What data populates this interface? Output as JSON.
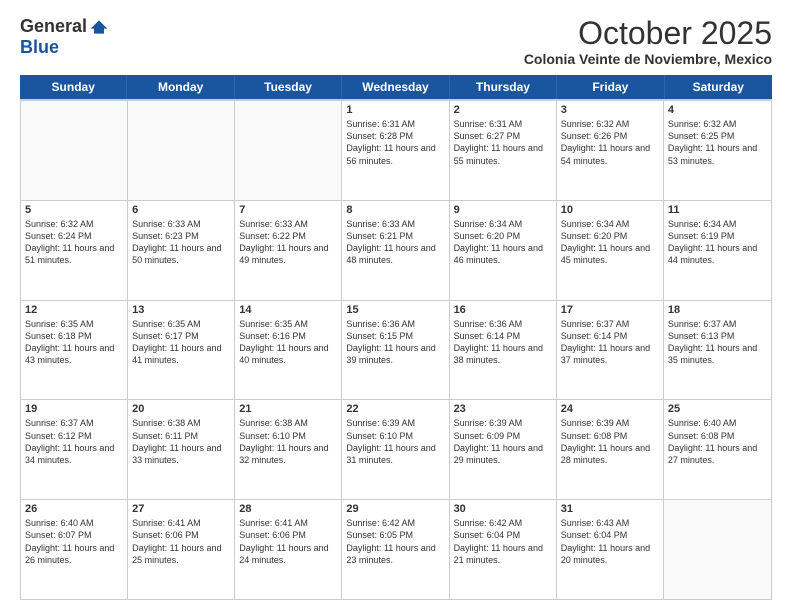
{
  "logo": {
    "general": "General",
    "blue": "Blue"
  },
  "header": {
    "month": "October 2025",
    "location": "Colonia Veinte de Noviembre, Mexico"
  },
  "weekdays": [
    "Sunday",
    "Monday",
    "Tuesday",
    "Wednesday",
    "Thursday",
    "Friday",
    "Saturday"
  ],
  "weeks": [
    [
      {
        "day": "",
        "info": ""
      },
      {
        "day": "",
        "info": ""
      },
      {
        "day": "",
        "info": ""
      },
      {
        "day": "1",
        "info": "Sunrise: 6:31 AM\nSunset: 6:28 PM\nDaylight: 11 hours and 56 minutes."
      },
      {
        "day": "2",
        "info": "Sunrise: 6:31 AM\nSunset: 6:27 PM\nDaylight: 11 hours and 55 minutes."
      },
      {
        "day": "3",
        "info": "Sunrise: 6:32 AM\nSunset: 6:26 PM\nDaylight: 11 hours and 54 minutes."
      },
      {
        "day": "4",
        "info": "Sunrise: 6:32 AM\nSunset: 6:25 PM\nDaylight: 11 hours and 53 minutes."
      }
    ],
    [
      {
        "day": "5",
        "info": "Sunrise: 6:32 AM\nSunset: 6:24 PM\nDaylight: 11 hours and 51 minutes."
      },
      {
        "day": "6",
        "info": "Sunrise: 6:33 AM\nSunset: 6:23 PM\nDaylight: 11 hours and 50 minutes."
      },
      {
        "day": "7",
        "info": "Sunrise: 6:33 AM\nSunset: 6:22 PM\nDaylight: 11 hours and 49 minutes."
      },
      {
        "day": "8",
        "info": "Sunrise: 6:33 AM\nSunset: 6:21 PM\nDaylight: 11 hours and 48 minutes."
      },
      {
        "day": "9",
        "info": "Sunrise: 6:34 AM\nSunset: 6:20 PM\nDaylight: 11 hours and 46 minutes."
      },
      {
        "day": "10",
        "info": "Sunrise: 6:34 AM\nSunset: 6:20 PM\nDaylight: 11 hours and 45 minutes."
      },
      {
        "day": "11",
        "info": "Sunrise: 6:34 AM\nSunset: 6:19 PM\nDaylight: 11 hours and 44 minutes."
      }
    ],
    [
      {
        "day": "12",
        "info": "Sunrise: 6:35 AM\nSunset: 6:18 PM\nDaylight: 11 hours and 43 minutes."
      },
      {
        "day": "13",
        "info": "Sunrise: 6:35 AM\nSunset: 6:17 PM\nDaylight: 11 hours and 41 minutes."
      },
      {
        "day": "14",
        "info": "Sunrise: 6:35 AM\nSunset: 6:16 PM\nDaylight: 11 hours and 40 minutes."
      },
      {
        "day": "15",
        "info": "Sunrise: 6:36 AM\nSunset: 6:15 PM\nDaylight: 11 hours and 39 minutes."
      },
      {
        "day": "16",
        "info": "Sunrise: 6:36 AM\nSunset: 6:14 PM\nDaylight: 11 hours and 38 minutes."
      },
      {
        "day": "17",
        "info": "Sunrise: 6:37 AM\nSunset: 6:14 PM\nDaylight: 11 hours and 37 minutes."
      },
      {
        "day": "18",
        "info": "Sunrise: 6:37 AM\nSunset: 6:13 PM\nDaylight: 11 hours and 35 minutes."
      }
    ],
    [
      {
        "day": "19",
        "info": "Sunrise: 6:37 AM\nSunset: 6:12 PM\nDaylight: 11 hours and 34 minutes."
      },
      {
        "day": "20",
        "info": "Sunrise: 6:38 AM\nSunset: 6:11 PM\nDaylight: 11 hours and 33 minutes."
      },
      {
        "day": "21",
        "info": "Sunrise: 6:38 AM\nSunset: 6:10 PM\nDaylight: 11 hours and 32 minutes."
      },
      {
        "day": "22",
        "info": "Sunrise: 6:39 AM\nSunset: 6:10 PM\nDaylight: 11 hours and 31 minutes."
      },
      {
        "day": "23",
        "info": "Sunrise: 6:39 AM\nSunset: 6:09 PM\nDaylight: 11 hours and 29 minutes."
      },
      {
        "day": "24",
        "info": "Sunrise: 6:39 AM\nSunset: 6:08 PM\nDaylight: 11 hours and 28 minutes."
      },
      {
        "day": "25",
        "info": "Sunrise: 6:40 AM\nSunset: 6:08 PM\nDaylight: 11 hours and 27 minutes."
      }
    ],
    [
      {
        "day": "26",
        "info": "Sunrise: 6:40 AM\nSunset: 6:07 PM\nDaylight: 11 hours and 26 minutes."
      },
      {
        "day": "27",
        "info": "Sunrise: 6:41 AM\nSunset: 6:06 PM\nDaylight: 11 hours and 25 minutes."
      },
      {
        "day": "28",
        "info": "Sunrise: 6:41 AM\nSunset: 6:06 PM\nDaylight: 11 hours and 24 minutes."
      },
      {
        "day": "29",
        "info": "Sunrise: 6:42 AM\nSunset: 6:05 PM\nDaylight: 11 hours and 23 minutes."
      },
      {
        "day": "30",
        "info": "Sunrise: 6:42 AM\nSunset: 6:04 PM\nDaylight: 11 hours and 21 minutes."
      },
      {
        "day": "31",
        "info": "Sunrise: 6:43 AM\nSunset: 6:04 PM\nDaylight: 11 hours and 20 minutes."
      },
      {
        "day": "",
        "info": ""
      }
    ]
  ]
}
